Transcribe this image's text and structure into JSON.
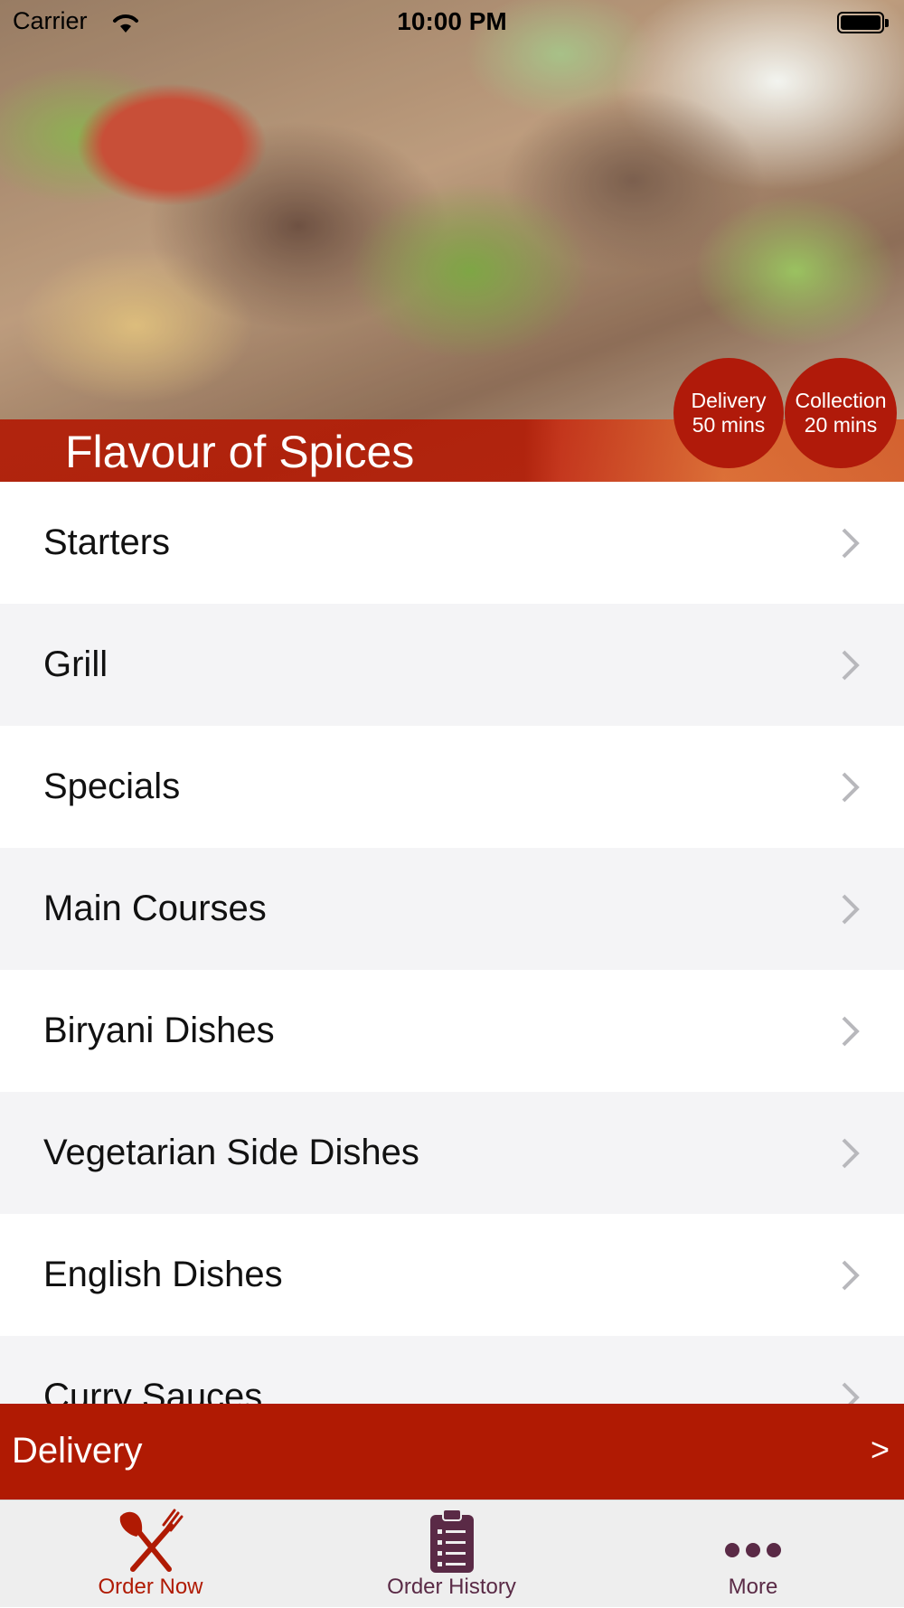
{
  "status_bar": {
    "carrier": "Carrier",
    "time": "10:00 PM"
  },
  "hero": {
    "restaurant_name": "Flavour of Spices",
    "badges": [
      {
        "line1": "Delivery",
        "line2": "50 mins"
      },
      {
        "line1": "Collection",
        "line2": "20 mins"
      }
    ]
  },
  "menu": {
    "items": [
      {
        "label": "Starters"
      },
      {
        "label": "Grill"
      },
      {
        "label": "Specials"
      },
      {
        "label": "Main Courses"
      },
      {
        "label": "Biryani Dishes"
      },
      {
        "label": "Vegetarian Side Dishes"
      },
      {
        "label": "English Dishes"
      },
      {
        "label": "Curry Sauces"
      }
    ]
  },
  "delivery_bar": {
    "label": "Delivery",
    "arrow": ">"
  },
  "tab_bar": {
    "tabs": [
      {
        "label": "Order Now",
        "icon": "fork-knife-icon",
        "active": true
      },
      {
        "label": "Order History",
        "icon": "clipboard-icon",
        "active": false
      },
      {
        "label": "More",
        "icon": "more-dots-icon",
        "active": false
      }
    ]
  },
  "colors": {
    "accent": "#b01a03",
    "tab_active": "#b01a03",
    "tab_inactive": "#5a2a46",
    "row_alt": "#f4f4f6"
  }
}
